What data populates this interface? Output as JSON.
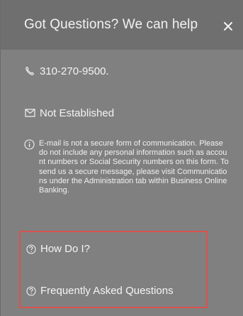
{
  "header": {
    "title": "Got Questions? We can help",
    "close_icon": "close-icon"
  },
  "contact": {
    "phone": {
      "icon": "phone-icon",
      "text": "310-270-9500."
    },
    "email": {
      "icon": "envelope-icon",
      "text": "Not Established"
    }
  },
  "notice": {
    "icon": "info-icon",
    "text": "E-mail is not a secure form of communication. Please do not include any personal information such as account numbers or Social Security numbers on this form. To send us a secure message, please visit Communications under the Administration tab within Business Online Banking."
  },
  "help_links": [
    {
      "icon": "question-circle-icon",
      "label": "How Do I?"
    },
    {
      "icon": "question-circle-icon",
      "label": "Frequently Asked Questions"
    }
  ],
  "colors": {
    "highlight_border": "#d9534f",
    "header_bg": "#6f6f6f",
    "panel_bg": "#808080"
  }
}
